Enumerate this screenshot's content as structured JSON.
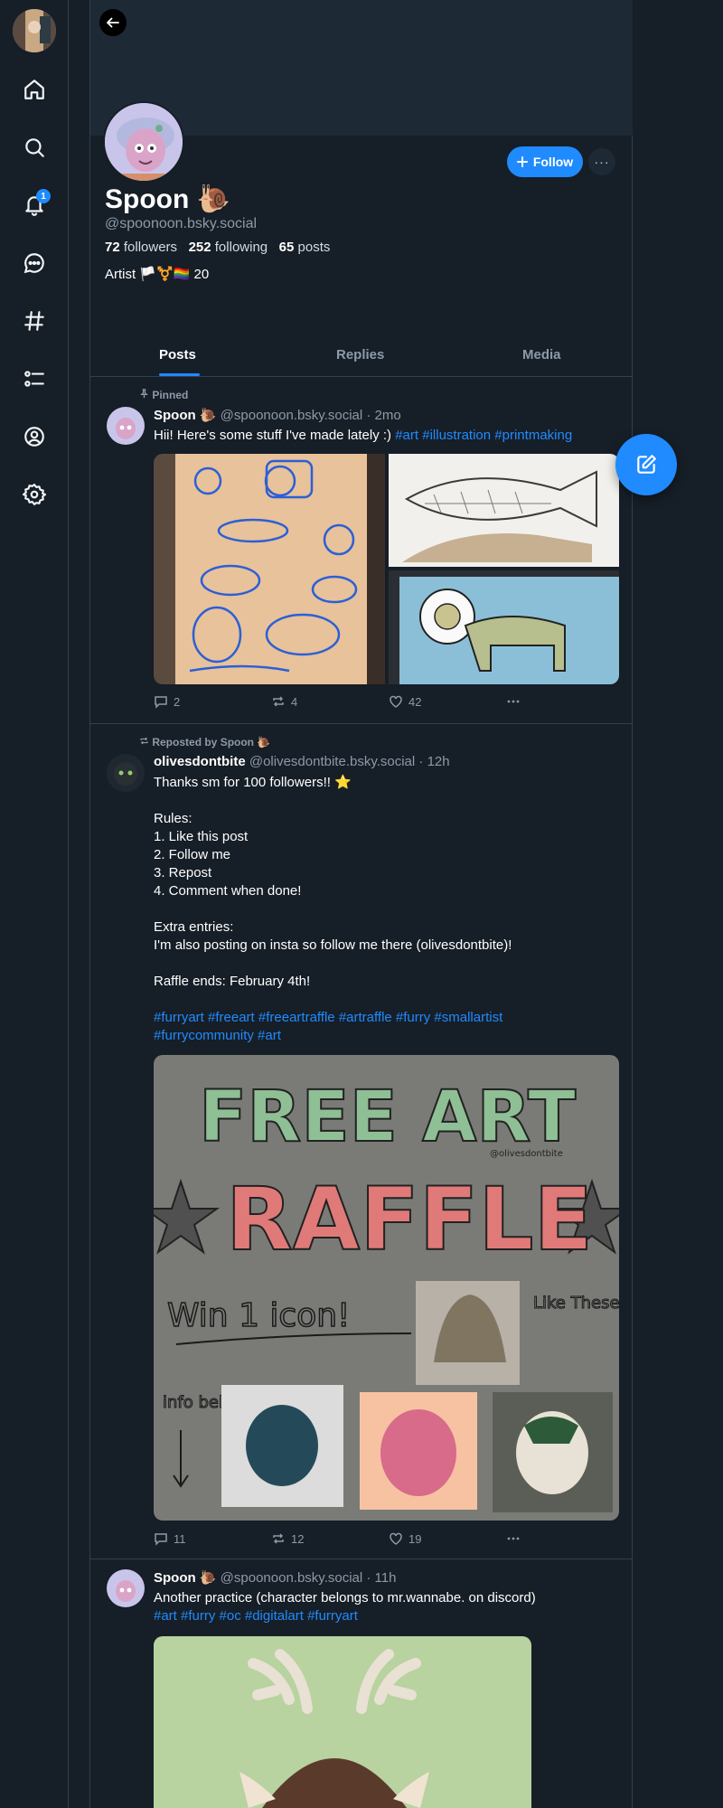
{
  "nav": {
    "items": [
      "Home",
      "Search",
      "Notifications",
      "Chat",
      "Feeds",
      "Lists",
      "Profile",
      "Settings"
    ],
    "notifications_count": "1"
  },
  "profile": {
    "display_name": "Spoon 🐌",
    "handle": "@spoonoon.bsky.social",
    "followers_count": "72",
    "followers_label": "followers",
    "following_count": "252",
    "following_label": "following",
    "posts_count": "65",
    "posts_label": "posts",
    "bio": "Artist 🏳️⚧️🏳️‍🌈 20",
    "follow_label": "Follow",
    "more_label": "···"
  },
  "tabs": [
    "Posts",
    "Replies",
    "Media"
  ],
  "posts": [
    {
      "context": "Pinned",
      "author": "Spoon 🐌",
      "handle": "@spoonoon.bsky.social",
      "time": "· 2mo",
      "text": "Hii! Here's some stuff I've made lately :)",
      "tags": [
        "#art",
        "#illustration",
        "#printmaking"
      ],
      "replies": "2",
      "reposts": "4",
      "likes": "42"
    },
    {
      "context": "Reposted by Spoon 🐌",
      "author": "olivesdontbite",
      "handle": "@olivesdontbite.bsky.social",
      "time": "· 12h",
      "lines": [
        "Thanks sm for 100 followers!! ⭐",
        "",
        "Rules:",
        "1. Like this post",
        "2. Follow me",
        "3. Repost",
        "4. Comment when done!",
        "",
        "Extra entries:",
        "I'm also posting on insta so follow me there (olivesdontbite)!",
        "",
        "Raffle ends: February 4th!"
      ],
      "tags_line1": "#furryart #freeart #freeartraffle #artraffle #furry #smallartist",
      "tags_line2": "#furrycommunity #art",
      "image_text": {
        "line1": "FREE ART",
        "line2": "RAFFLE",
        "line3": "Win 1 icon!",
        "like_these": "Like These!",
        "info_below": "info below!",
        "credit": "@olivesdontbite"
      },
      "replies": "11",
      "reposts": "12",
      "likes": "19"
    },
    {
      "author": "Spoon 🐌",
      "handle": "@spoonoon.bsky.social",
      "time": "· 11h",
      "text": "Another practice (character belongs to mr.wannabe. on discord)",
      "tags": "#art #furry #oc #digitalart #furryart"
    }
  ],
  "colors": {
    "background": "#161e27",
    "accent": "#208bfe",
    "border": "#2e4052",
    "muted_text": "#8d9aa8"
  }
}
